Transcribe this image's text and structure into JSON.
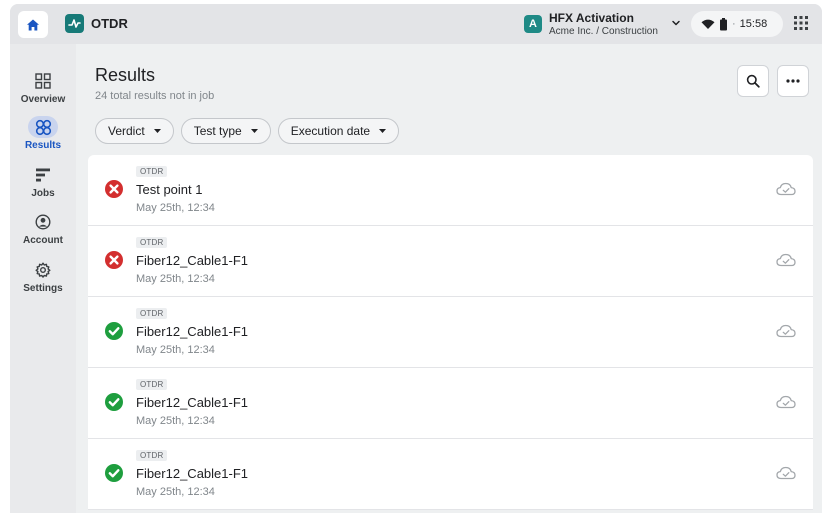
{
  "topbar": {
    "app_title": "OTDR",
    "org_initial": "A",
    "org_name": "HFX Activation",
    "org_path": "Acme Inc. / Construction",
    "time": "15:58",
    "status_separator": "·"
  },
  "sidebar": {
    "items": [
      {
        "label": "Overview",
        "icon": "dashboard-icon",
        "active": false
      },
      {
        "label": "Results",
        "icon": "results-icon",
        "active": true
      },
      {
        "label": "Jobs",
        "icon": "jobs-icon",
        "active": false
      },
      {
        "label": "Account",
        "icon": "account-icon",
        "active": false
      },
      {
        "label": "Settings",
        "icon": "settings-icon",
        "active": false
      }
    ]
  },
  "main": {
    "title": "Results",
    "subtitle": "24 total results not in job",
    "filters": [
      {
        "label": "Verdict"
      },
      {
        "label": "Test type"
      },
      {
        "label": "Execution date"
      }
    ],
    "results": [
      {
        "tag": "OTDR",
        "name": "Test point 1",
        "date": "May 25th, 12:34",
        "verdict": "fail"
      },
      {
        "tag": "OTDR",
        "name": "Fiber12_Cable1-F1",
        "date": "May 25th, 12:34",
        "verdict": "fail"
      },
      {
        "tag": "OTDR",
        "name": "Fiber12_Cable1-F1",
        "date": "May 25th, 12:34",
        "verdict": "pass"
      },
      {
        "tag": "OTDR",
        "name": "Fiber12_Cable1-F1",
        "date": "May 25th, 12:34",
        "verdict": "pass"
      },
      {
        "tag": "OTDR",
        "name": "Fiber12_Cable1-F1",
        "date": "May 25th, 12:34",
        "verdict": "pass"
      }
    ]
  },
  "colors": {
    "accent": "#1a56c2",
    "teal": "#177a78",
    "fail": "#d32f2f",
    "pass": "#1e9e3e"
  }
}
